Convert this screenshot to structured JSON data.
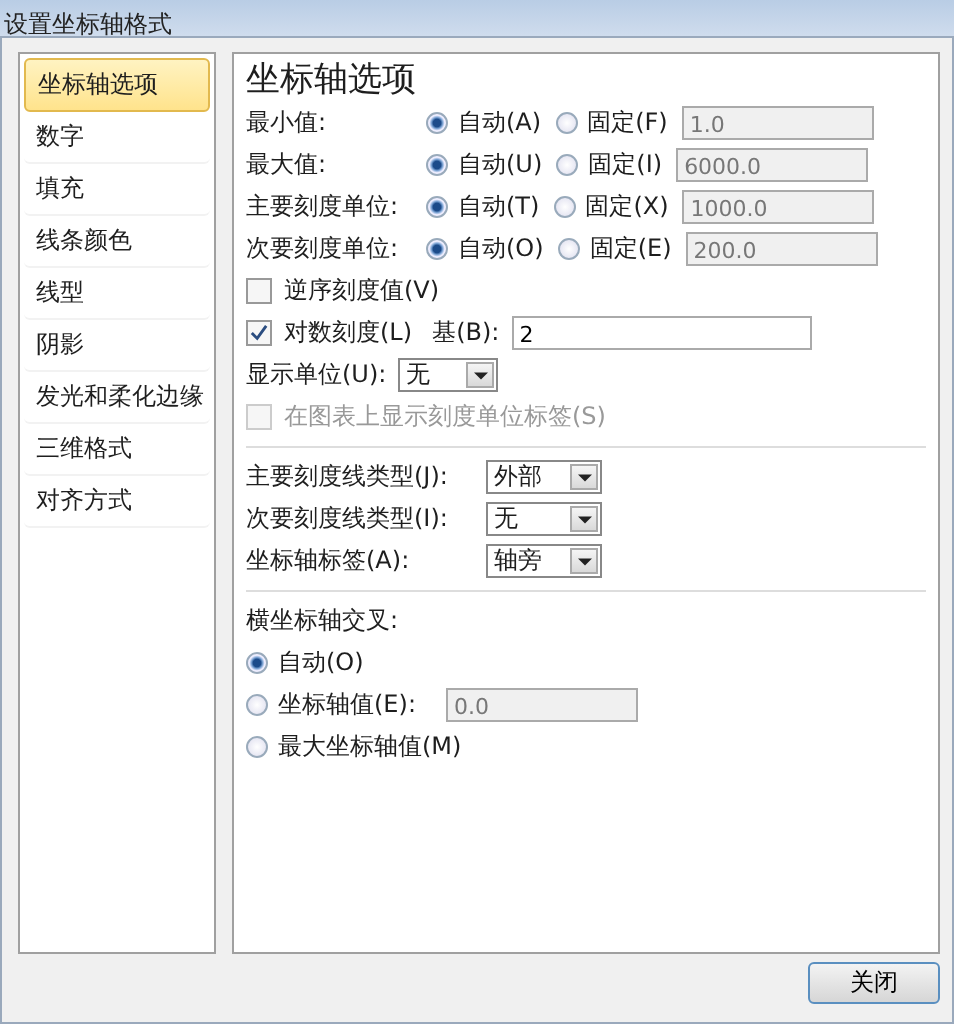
{
  "window": {
    "title": "设置坐标轴格式"
  },
  "sidebar": {
    "items": [
      {
        "label": "坐标轴选项",
        "selected": true
      },
      {
        "label": "数字",
        "selected": false
      },
      {
        "label": "填充",
        "selected": false
      },
      {
        "label": "线条颜色",
        "selected": false
      },
      {
        "label": "线型",
        "selected": false
      },
      {
        "label": "阴影",
        "selected": false
      },
      {
        "label": "发光和柔化边缘",
        "selected": false
      },
      {
        "label": "三维格式",
        "selected": false
      },
      {
        "label": "对齐方式",
        "selected": false
      }
    ]
  },
  "panel": {
    "title": "坐标轴选项",
    "bounds": [
      {
        "label": "最小值:",
        "options": [
          {
            "label": "自动(A)",
            "selected": true
          },
          {
            "label": "固定(F)",
            "selected": false
          }
        ],
        "value": "1.0"
      },
      {
        "label": "最大值:",
        "options": [
          {
            "label": "自动(U)",
            "selected": true
          },
          {
            "label": "固定(I)",
            "selected": false
          }
        ],
        "value": "6000.0"
      },
      {
        "label": "主要刻度单位:",
        "options": [
          {
            "label": "自动(T)",
            "selected": true
          },
          {
            "label": "固定(X)",
            "selected": false
          }
        ],
        "value": "1000.0"
      },
      {
        "label": "次要刻度单位:",
        "options": [
          {
            "label": "自动(O)",
            "selected": true
          },
          {
            "label": "固定(E)",
            "selected": false
          }
        ],
        "value": "200.0"
      }
    ],
    "reverse": {
      "label": "逆序刻度值(V)",
      "checked": false
    },
    "log": {
      "label": "对数刻度(L)",
      "checked": true,
      "base_label": "基(B):",
      "base_value": "2"
    },
    "display_units": {
      "label": "显示单位(U):",
      "value": "无"
    },
    "show_units_label": {
      "label": "在图表上显示刻度单位标签(S)",
      "checked": false,
      "disabled": true
    },
    "ticks": [
      {
        "label": "主要刻度线类型(J):",
        "value": "外部"
      },
      {
        "label": "次要刻度线类型(I):",
        "value": "无"
      },
      {
        "label": "坐标轴标签(A):",
        "value": "轴旁"
      }
    ],
    "cross": {
      "label": "横坐标轴交叉:",
      "options": [
        {
          "label": "自动(O)",
          "selected": true
        },
        {
          "label": "坐标轴值(E):",
          "selected": false,
          "value": "0.0"
        },
        {
          "label": "最大坐标轴值(M)",
          "selected": false
        }
      ]
    }
  },
  "buttons": [
    "关闭"
  ]
}
